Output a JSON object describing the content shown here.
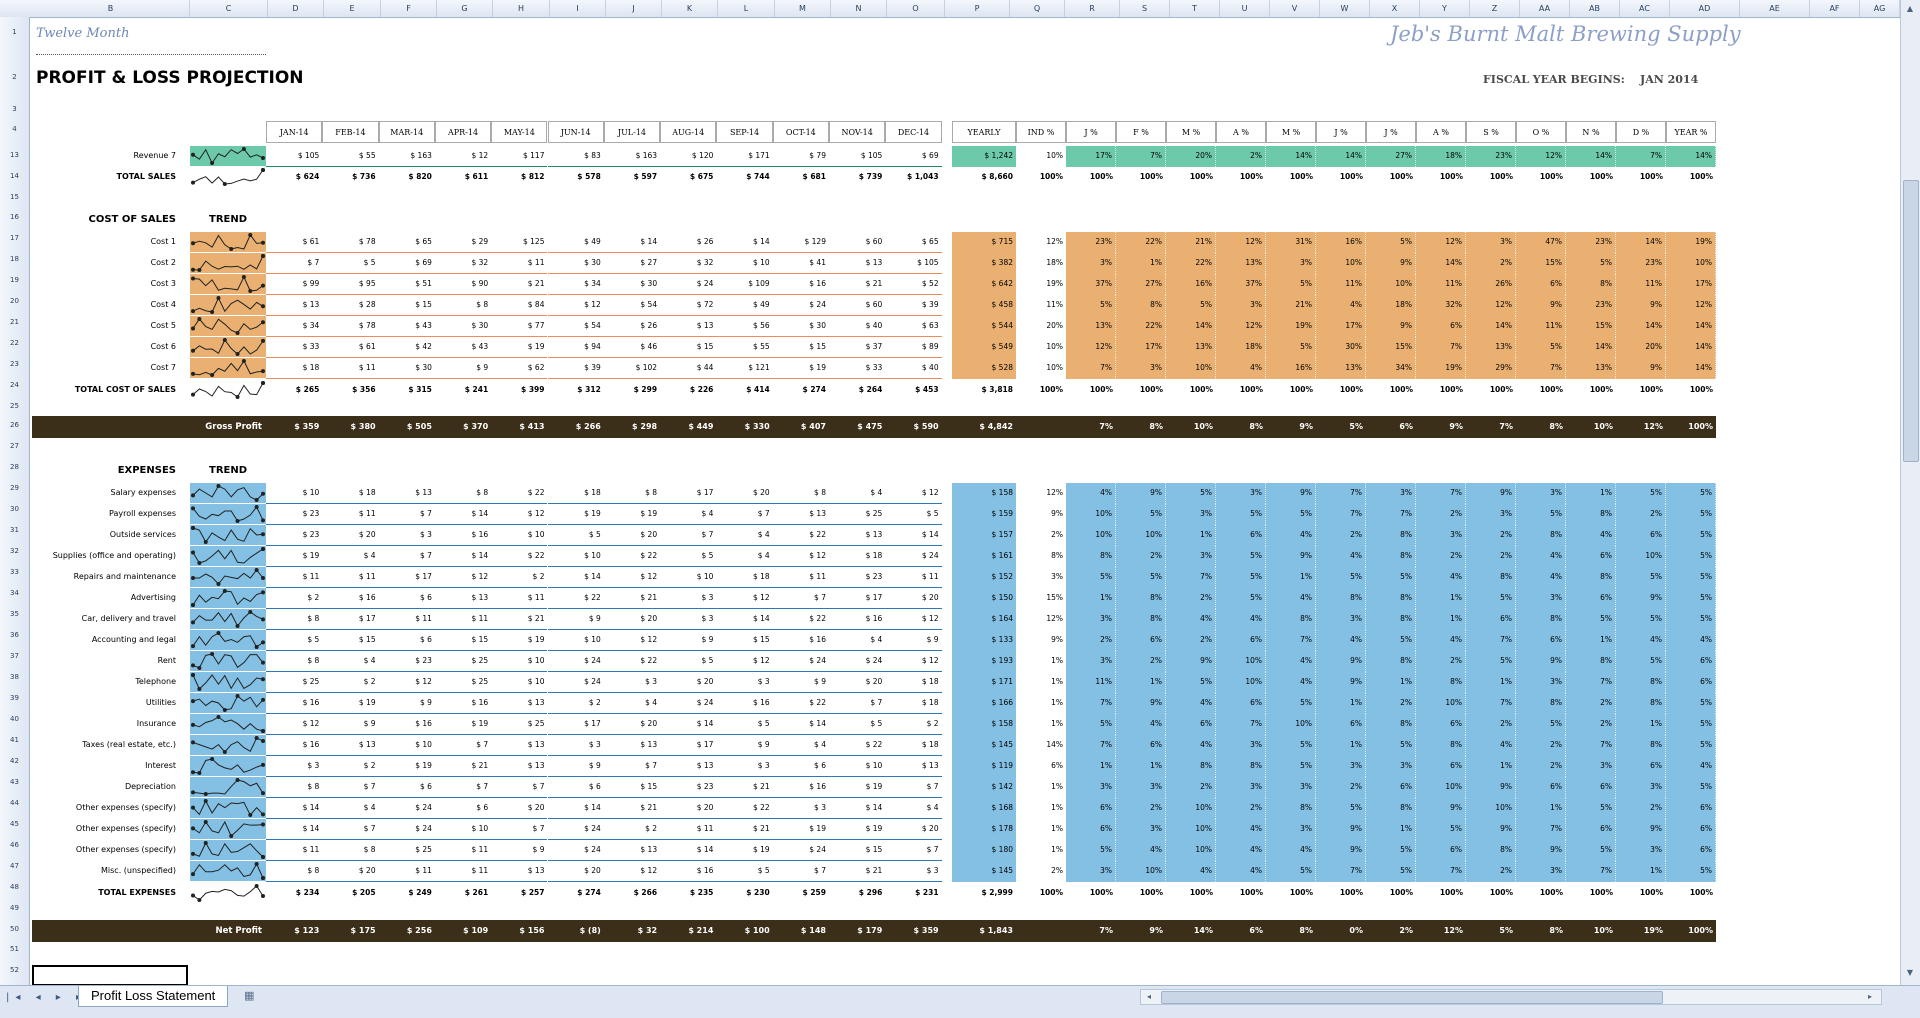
{
  "column_headers": [
    "B",
    "C",
    "D",
    "E",
    "F",
    "G",
    "H",
    "I",
    "J",
    "K",
    "L",
    "M",
    "N",
    "O",
    "P",
    "Q",
    "R",
    "S",
    "T",
    "U",
    "V",
    "W",
    "X",
    "Y",
    "Z",
    "AA",
    "AB",
    "AC",
    "AD",
    "AE",
    "AF",
    "AG"
  ],
  "row_numbers": [
    "1",
    "2",
    "3",
    "4",
    "13",
    "14",
    "15",
    "16",
    "17",
    "18",
    "19",
    "20",
    "21",
    "22",
    "23",
    "24",
    "25",
    "26",
    "27",
    "28",
    "29",
    "30",
    "31",
    "32",
    "33",
    "34",
    "35",
    "36",
    "37",
    "38",
    "39",
    "40",
    "41",
    "42",
    "43",
    "44",
    "45",
    "46",
    "47",
    "48",
    "49",
    "50",
    "51",
    "52"
  ],
  "title_small": "Twelve Month",
  "brand": "Jeb's Burnt Malt Brewing Supply",
  "title": "PROFIT & LOSS PROJECTION",
  "fiscal_label": "FISCAL YEAR BEGINS:",
  "fiscal_value": "JAN 2014",
  "month_headers": [
    "JAN-14",
    "FEB-14",
    "MAR-14",
    "APR-14",
    "MAY-14",
    "JUN-14",
    "JUL-14",
    "AUG-14",
    "SEP-14",
    "OCT-14",
    "NOV-14",
    "DEC-14"
  ],
  "yearly_header": "YEARLY",
  "ind_header": "IND %",
  "pct_headers": [
    "J %",
    "F %",
    "M %",
    "A %",
    "M %",
    "J %",
    "J %",
    "A %",
    "S %",
    "O %",
    "N %",
    "D %",
    "YEAR %"
  ],
  "revenue": {
    "label": "Revenue 7",
    "values": [
      "$ 105",
      "$ 55",
      "$ 163",
      "$ 12",
      "$ 117",
      "$ 83",
      "$ 163",
      "$ 120",
      "$ 171",
      "$ 79",
      "$ 105",
      "$ 69"
    ],
    "yearly": "$ 1,242",
    "ind": "10%",
    "pcts": [
      "17%",
      "7%",
      "20%",
      "2%",
      "14%",
      "14%",
      "27%",
      "18%",
      "23%",
      "12%",
      "14%",
      "7%",
      "14%"
    ]
  },
  "total_sales": {
    "label": "TOTAL SALES",
    "values": [
      "$ 624",
      "$ 736",
      "$ 820",
      "$ 611",
      "$ 812",
      "$ 578",
      "$ 597",
      "$ 675",
      "$ 744",
      "$ 681",
      "$ 739",
      "$ 1,043"
    ],
    "yearly": "$ 8,660",
    "ind": "100%",
    "pcts": [
      "100%",
      "100%",
      "100%",
      "100%",
      "100%",
      "100%",
      "100%",
      "100%",
      "100%",
      "100%",
      "100%",
      "100%",
      "100%"
    ]
  },
  "cost_section": {
    "label": "COST OF SALES",
    "trend": "TREND"
  },
  "cost_rows": [
    {
      "label": "Cost 1",
      "values": [
        "$ 61",
        "$ 78",
        "$ 65",
        "$ 29",
        "$ 125",
        "$ 49",
        "$ 14",
        "$ 26",
        "$ 14",
        "$ 129",
        "$ 60",
        "$ 65"
      ],
      "yearly": "$ 715",
      "ind": "12%",
      "pcts": [
        "23%",
        "22%",
        "21%",
        "12%",
        "31%",
        "16%",
        "5%",
        "12%",
        "3%",
        "47%",
        "23%",
        "14%",
        "19%"
      ]
    },
    {
      "label": "Cost 2",
      "values": [
        "$ 7",
        "$ 5",
        "$ 69",
        "$ 32",
        "$ 11",
        "$ 30",
        "$ 27",
        "$ 32",
        "$ 10",
        "$ 41",
        "$ 13",
        "$ 105"
      ],
      "yearly": "$ 382",
      "ind": "18%",
      "pcts": [
        "3%",
        "1%",
        "22%",
        "13%",
        "3%",
        "10%",
        "9%",
        "14%",
        "2%",
        "15%",
        "5%",
        "23%",
        "10%"
      ]
    },
    {
      "label": "Cost 3",
      "values": [
        "$ 99",
        "$ 95",
        "$ 51",
        "$ 90",
        "$ 21",
        "$ 34",
        "$ 30",
        "$ 24",
        "$ 109",
        "$ 16",
        "$ 21",
        "$ 52"
      ],
      "yearly": "$ 642",
      "ind": "19%",
      "pcts": [
        "37%",
        "27%",
        "16%",
        "37%",
        "5%",
        "11%",
        "10%",
        "11%",
        "26%",
        "6%",
        "8%",
        "11%",
        "17%"
      ]
    },
    {
      "label": "Cost 4",
      "values": [
        "$ 13",
        "$ 28",
        "$ 15",
        "$ 8",
        "$ 84",
        "$ 12",
        "$ 54",
        "$ 72",
        "$ 49",
        "$ 24",
        "$ 60",
        "$ 39"
      ],
      "yearly": "$ 458",
      "ind": "11%",
      "pcts": [
        "5%",
        "8%",
        "5%",
        "3%",
        "21%",
        "4%",
        "18%",
        "32%",
        "12%",
        "9%",
        "23%",
        "9%",
        "12%"
      ]
    },
    {
      "label": "Cost 5",
      "values": [
        "$ 34",
        "$ 78",
        "$ 43",
        "$ 30",
        "$ 77",
        "$ 54",
        "$ 26",
        "$ 13",
        "$ 56",
        "$ 30",
        "$ 40",
        "$ 63"
      ],
      "yearly": "$ 544",
      "ind": "20%",
      "pcts": [
        "13%",
        "22%",
        "14%",
        "12%",
        "19%",
        "17%",
        "9%",
        "6%",
        "14%",
        "11%",
        "15%",
        "14%",
        "14%"
      ]
    },
    {
      "label": "Cost 6",
      "values": [
        "$ 33",
        "$ 61",
        "$ 42",
        "$ 43",
        "$ 19",
        "$ 94",
        "$ 46",
        "$ 15",
        "$ 55",
        "$ 15",
        "$ 37",
        "$ 89"
      ],
      "yearly": "$ 549",
      "ind": "10%",
      "pcts": [
        "12%",
        "17%",
        "13%",
        "18%",
        "5%",
        "30%",
        "15%",
        "7%",
        "13%",
        "5%",
        "14%",
        "20%",
        "14%"
      ]
    },
    {
      "label": "Cost 7",
      "values": [
        "$ 18",
        "$ 11",
        "$ 30",
        "$ 9",
        "$ 62",
        "$ 39",
        "$ 102",
        "$ 44",
        "$ 121",
        "$ 19",
        "$ 33",
        "$ 40"
      ],
      "yearly": "$ 528",
      "ind": "10%",
      "pcts": [
        "7%",
        "3%",
        "10%",
        "4%",
        "16%",
        "13%",
        "34%",
        "19%",
        "29%",
        "7%",
        "13%",
        "9%",
        "14%"
      ]
    }
  ],
  "total_cost": {
    "label": "TOTAL COST OF SALES",
    "values": [
      "$ 265",
      "$ 356",
      "$ 315",
      "$ 241",
      "$ 399",
      "$ 312",
      "$ 299",
      "$ 226",
      "$ 414",
      "$ 274",
      "$ 264",
      "$ 453"
    ],
    "yearly": "$ 3,818",
    "ind": "100%",
    "pcts": [
      "100%",
      "100%",
      "100%",
      "100%",
      "100%",
      "100%",
      "100%",
      "100%",
      "100%",
      "100%",
      "100%",
      "100%",
      "100%"
    ]
  },
  "gross_profit": {
    "label": "Gross Profit",
    "values": [
      "$ 359",
      "$ 380",
      "$ 505",
      "$ 370",
      "$ 413",
      "$ 266",
      "$ 298",
      "$ 449",
      "$ 330",
      "$ 407",
      "$ 475",
      "$ 590"
    ],
    "yearly": "$ 4,842",
    "pcts": [
      "7%",
      "8%",
      "10%",
      "8%",
      "9%",
      "5%",
      "6%",
      "9%",
      "7%",
      "8%",
      "10%",
      "12%",
      "100%"
    ]
  },
  "expense_section": {
    "label": "EXPENSES",
    "trend": "TREND"
  },
  "expense_rows": [
    {
      "label": "Salary expenses",
      "values": [
        "$ 10",
        "$ 18",
        "$ 13",
        "$ 8",
        "$ 22",
        "$ 18",
        "$ 8",
        "$ 17",
        "$ 20",
        "$ 8",
        "$ 4",
        "$ 12"
      ],
      "yearly": "$ 158",
      "ind": "12%",
      "pcts": [
        "4%",
        "9%",
        "5%",
        "3%",
        "9%",
        "7%",
        "3%",
        "7%",
        "9%",
        "3%",
        "1%",
        "5%",
        "5%"
      ]
    },
    {
      "label": "Payroll expenses",
      "values": [
        "$ 23",
        "$ 11",
        "$ 7",
        "$ 14",
        "$ 12",
        "$ 19",
        "$ 19",
        "$ 4",
        "$ 7",
        "$ 13",
        "$ 25",
        "$ 5"
      ],
      "yearly": "$ 159",
      "ind": "9%",
      "pcts": [
        "10%",
        "5%",
        "3%",
        "5%",
        "5%",
        "7%",
        "7%",
        "2%",
        "3%",
        "5%",
        "8%",
        "2%",
        "5%"
      ]
    },
    {
      "label": "Outside services",
      "values": [
        "$ 23",
        "$ 20",
        "$ 3",
        "$ 16",
        "$ 10",
        "$ 5",
        "$ 20",
        "$ 7",
        "$ 4",
        "$ 22",
        "$ 13",
        "$ 14"
      ],
      "yearly": "$ 157",
      "ind": "2%",
      "pcts": [
        "10%",
        "10%",
        "1%",
        "6%",
        "4%",
        "2%",
        "8%",
        "3%",
        "2%",
        "8%",
        "4%",
        "6%",
        "5%"
      ]
    },
    {
      "label": "Supplies (office and operating)",
      "values": [
        "$ 19",
        "$ 4",
        "$ 7",
        "$ 14",
        "$ 22",
        "$ 10",
        "$ 22",
        "$ 5",
        "$ 4",
        "$ 12",
        "$ 18",
        "$ 24"
      ],
      "yearly": "$ 161",
      "ind": "8%",
      "pcts": [
        "8%",
        "2%",
        "3%",
        "5%",
        "9%",
        "4%",
        "8%",
        "2%",
        "2%",
        "4%",
        "6%",
        "10%",
        "5%"
      ]
    },
    {
      "label": "Repairs and maintenance",
      "values": [
        "$ 11",
        "$ 11",
        "$ 17",
        "$ 12",
        "$ 2",
        "$ 14",
        "$ 12",
        "$ 10",
        "$ 18",
        "$ 11",
        "$ 23",
        "$ 11"
      ],
      "yearly": "$ 152",
      "ind": "3%",
      "pcts": [
        "5%",
        "5%",
        "7%",
        "5%",
        "1%",
        "5%",
        "5%",
        "4%",
        "8%",
        "4%",
        "8%",
        "5%",
        "5%"
      ]
    },
    {
      "label": "Advertising",
      "values": [
        "$ 2",
        "$ 16",
        "$ 6",
        "$ 13",
        "$ 11",
        "$ 22",
        "$ 21",
        "$ 3",
        "$ 12",
        "$ 7",
        "$ 17",
        "$ 20"
      ],
      "yearly": "$ 150",
      "ind": "15%",
      "pcts": [
        "1%",
        "8%",
        "2%",
        "5%",
        "4%",
        "8%",
        "8%",
        "1%",
        "5%",
        "3%",
        "6%",
        "9%",
        "5%"
      ]
    },
    {
      "label": "Car, delivery and travel",
      "values": [
        "$ 8",
        "$ 17",
        "$ 11",
        "$ 11",
        "$ 21",
        "$ 9",
        "$ 20",
        "$ 3",
        "$ 14",
        "$ 22",
        "$ 16",
        "$ 12"
      ],
      "yearly": "$ 164",
      "ind": "12%",
      "pcts": [
        "3%",
        "8%",
        "4%",
        "4%",
        "8%",
        "3%",
        "8%",
        "1%",
        "6%",
        "8%",
        "5%",
        "5%",
        "5%"
      ]
    },
    {
      "label": "Accounting and legal",
      "values": [
        "$ 5",
        "$ 15",
        "$ 6",
        "$ 15",
        "$ 19",
        "$ 10",
        "$ 12",
        "$ 9",
        "$ 15",
        "$ 16",
        "$ 4",
        "$ 9"
      ],
      "yearly": "$ 133",
      "ind": "9%",
      "pcts": [
        "2%",
        "6%",
        "2%",
        "6%",
        "7%",
        "4%",
        "5%",
        "4%",
        "7%",
        "6%",
        "1%",
        "4%",
        "4%"
      ]
    },
    {
      "label": "Rent",
      "values": [
        "$ 8",
        "$ 4",
        "$ 23",
        "$ 25",
        "$ 10",
        "$ 24",
        "$ 22",
        "$ 5",
        "$ 12",
        "$ 24",
        "$ 24",
        "$ 12"
      ],
      "yearly": "$ 193",
      "ind": "1%",
      "pcts": [
        "3%",
        "2%",
        "9%",
        "10%",
        "4%",
        "9%",
        "8%",
        "2%",
        "5%",
        "9%",
        "8%",
        "5%",
        "6%"
      ]
    },
    {
      "label": "Telephone",
      "values": [
        "$ 25",
        "$ 2",
        "$ 12",
        "$ 25",
        "$ 10",
        "$ 24",
        "$ 3",
        "$ 20",
        "$ 3",
        "$ 9",
        "$ 20",
        "$ 18"
      ],
      "yearly": "$ 171",
      "ind": "1%",
      "pcts": [
        "11%",
        "1%",
        "5%",
        "10%",
        "4%",
        "9%",
        "1%",
        "8%",
        "1%",
        "3%",
        "7%",
        "8%",
        "6%"
      ]
    },
    {
      "label": "Utilities",
      "values": [
        "$ 16",
        "$ 19",
        "$ 9",
        "$ 16",
        "$ 13",
        "$ 2",
        "$ 4",
        "$ 24",
        "$ 16",
        "$ 22",
        "$ 7",
        "$ 18"
      ],
      "yearly": "$ 166",
      "ind": "1%",
      "pcts": [
        "7%",
        "9%",
        "4%",
        "6%",
        "5%",
        "1%",
        "2%",
        "10%",
        "7%",
        "8%",
        "2%",
        "8%",
        "5%"
      ]
    },
    {
      "label": "Insurance",
      "values": [
        "$ 12",
        "$ 9",
        "$ 16",
        "$ 19",
        "$ 25",
        "$ 17",
        "$ 20",
        "$ 14",
        "$ 5",
        "$ 14",
        "$ 5",
        "$ 2"
      ],
      "yearly": "$ 158",
      "ind": "1%",
      "pcts": [
        "5%",
        "4%",
        "6%",
        "7%",
        "10%",
        "6%",
        "8%",
        "6%",
        "2%",
        "5%",
        "2%",
        "1%",
        "5%"
      ]
    },
    {
      "label": "Taxes (real estate, etc.)",
      "values": [
        "$ 16",
        "$ 13",
        "$ 10",
        "$ 7",
        "$ 13",
        "$ 3",
        "$ 13",
        "$ 17",
        "$ 9",
        "$ 4",
        "$ 22",
        "$ 18"
      ],
      "yearly": "$ 145",
      "ind": "14%",
      "pcts": [
        "7%",
        "6%",
        "4%",
        "3%",
        "5%",
        "1%",
        "5%",
        "8%",
        "4%",
        "2%",
        "7%",
        "8%",
        "5%"
      ]
    },
    {
      "label": "Interest",
      "values": [
        "$ 3",
        "$ 2",
        "$ 19",
        "$ 21",
        "$ 13",
        "$ 9",
        "$ 7",
        "$ 13",
        "$ 3",
        "$ 6",
        "$ 10",
        "$ 13"
      ],
      "yearly": "$ 119",
      "ind": "6%",
      "pcts": [
        "1%",
        "1%",
        "8%",
        "8%",
        "5%",
        "3%",
        "3%",
        "6%",
        "1%",
        "2%",
        "3%",
        "6%",
        "4%"
      ]
    },
    {
      "label": "Depreciation",
      "values": [
        "$ 8",
        "$ 7",
        "$ 6",
        "$ 7",
        "$ 7",
        "$ 6",
        "$ 15",
        "$ 23",
        "$ 21",
        "$ 16",
        "$ 19",
        "$ 7"
      ],
      "yearly": "$ 142",
      "ind": "1%",
      "pcts": [
        "3%",
        "3%",
        "2%",
        "3%",
        "3%",
        "2%",
        "6%",
        "10%",
        "9%",
        "6%",
        "6%",
        "3%",
        "5%"
      ]
    },
    {
      "label": "Other expenses (specify)",
      "values": [
        "$ 14",
        "$ 4",
        "$ 24",
        "$ 6",
        "$ 20",
        "$ 14",
        "$ 21",
        "$ 20",
        "$ 22",
        "$ 3",
        "$ 14",
        "$ 4"
      ],
      "yearly": "$ 168",
      "ind": "1%",
      "pcts": [
        "6%",
        "2%",
        "10%",
        "2%",
        "8%",
        "5%",
        "8%",
        "9%",
        "10%",
        "1%",
        "5%",
        "2%",
        "6%"
      ]
    },
    {
      "label": "Other expenses (specify)",
      "values": [
        "$ 14",
        "$ 7",
        "$ 24",
        "$ 10",
        "$ 7",
        "$ 24",
        "$ 2",
        "$ 11",
        "$ 21",
        "$ 19",
        "$ 19",
        "$ 20"
      ],
      "yearly": "$ 178",
      "ind": "1%",
      "pcts": [
        "6%",
        "3%",
        "10%",
        "4%",
        "3%",
        "9%",
        "1%",
        "5%",
        "9%",
        "7%",
        "6%",
        "9%",
        "6%"
      ]
    },
    {
      "label": "Other expenses (specify)",
      "values": [
        "$ 11",
        "$ 8",
        "$ 25",
        "$ 11",
        "$ 9",
        "$ 24",
        "$ 13",
        "$ 14",
        "$ 19",
        "$ 24",
        "$ 15",
        "$ 7"
      ],
      "yearly": "$ 180",
      "ind": "1%",
      "pcts": [
        "5%",
        "4%",
        "10%",
        "4%",
        "4%",
        "9%",
        "5%",
        "6%",
        "8%",
        "9%",
        "5%",
        "3%",
        "6%"
      ]
    },
    {
      "label": "Misc. (unspecified)",
      "values": [
        "$ 8",
        "$ 20",
        "$ 11",
        "$ 11",
        "$ 13",
        "$ 20",
        "$ 12",
        "$ 16",
        "$ 5",
        "$ 7",
        "$ 21",
        "$ 3"
      ],
      "yearly": "$ 145",
      "ind": "2%",
      "pcts": [
        "3%",
        "10%",
        "4%",
        "4%",
        "5%",
        "7%",
        "5%",
        "7%",
        "2%",
        "3%",
        "7%",
        "1%",
        "5%"
      ]
    }
  ],
  "total_expenses": {
    "label": "TOTAL EXPENSES",
    "values": [
      "$ 234",
      "$ 205",
      "$ 249",
      "$ 261",
      "$ 257",
      "$ 274",
      "$ 266",
      "$ 235",
      "$ 230",
      "$ 259",
      "$ 296",
      "$ 231"
    ],
    "yearly": "$ 2,999",
    "ind": "100%",
    "pcts": [
      "100%",
      "100%",
      "100%",
      "100%",
      "100%",
      "100%",
      "100%",
      "100%",
      "100%",
      "100%",
      "100%",
      "100%",
      "100%"
    ]
  },
  "net_profit": {
    "label": "Net Profit",
    "values": [
      "$ 123",
      "$ 175",
      "$ 256",
      "$ 109",
      "$ 156",
      "$ (8)",
      "$ 32",
      "$ 214",
      "$ 100",
      "$ 148",
      "$ 179",
      "$ 359"
    ],
    "yearly": "$ 1,843",
    "pcts": [
      "7%",
      "9%",
      "14%",
      "6%",
      "8%",
      "0%",
      "2%",
      "12%",
      "5%",
      "8%",
      "10%",
      "19%",
      "100%"
    ]
  },
  "sheet_tab": "Profit Loss Statement",
  "colors": {
    "revenue": "#6cc9aa",
    "cost": "#e9b072",
    "expense": "#83c0e3",
    "band": "#3b2f1a",
    "cost_line": "#f08a5d",
    "expense_line": "#2f78b6"
  }
}
